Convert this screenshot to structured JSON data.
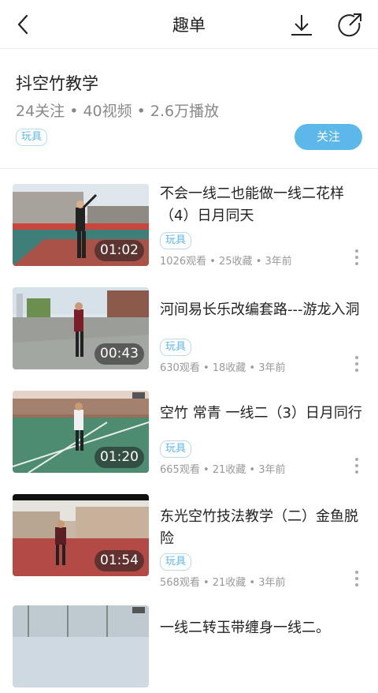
{
  "nav": {
    "title": "趣单",
    "icons": {
      "back": "back-arrow-icon",
      "download": "download-icon",
      "share": "share-icon"
    }
  },
  "playlist": {
    "name": "抖空竹教学",
    "stats": "24关注 • 40视频 • 2.6万播放",
    "tag": "玩具",
    "follow_label": "关注"
  },
  "videos": [
    {
      "title": "不会一线二也能做一线二花样（4）日月同天",
      "duration": "01:02",
      "tag": "玩具",
      "meta": "1026观看 • 25收藏 • 3年前"
    },
    {
      "title": "河间易长乐改编套路---游龙入洞",
      "duration": "00:43",
      "tag": "玩具",
      "meta": "630观看 • 18收藏 • 3年前"
    },
    {
      "title": "空竹 常青 一线二（3）日月同行",
      "duration": "01:20",
      "tag": "玩具",
      "meta": "665观看 • 21收藏 • 3年前"
    },
    {
      "title": "东光空竹技法教学（二）金鱼脱险",
      "duration": "01:54",
      "tag": "玩具",
      "meta": "568观看 • 21收藏 • 3年前"
    },
    {
      "title": "一线二转玉带缠身一线二。",
      "duration": "",
      "tag": "",
      "meta": ""
    }
  ],
  "colors": {
    "accent": "#5cb8e8",
    "tag": "#5bb6e6"
  }
}
